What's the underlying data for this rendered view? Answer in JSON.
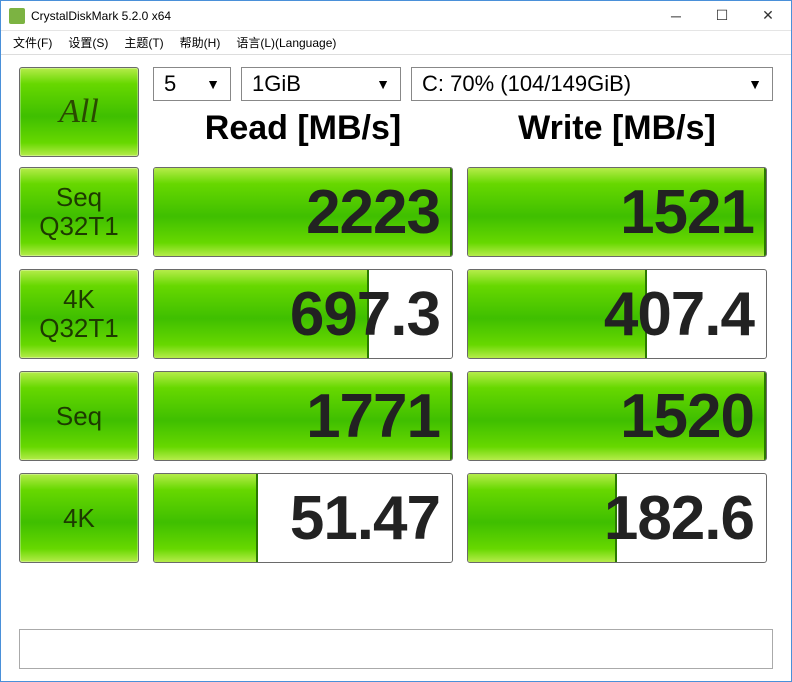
{
  "window": {
    "title": "CrystalDiskMark 5.2.0 x64"
  },
  "menu": {
    "file": "文件(F)",
    "settings": "设置(S)",
    "theme": "主题(T)",
    "help": "帮助(H)",
    "language": "语言(L)(Language)"
  },
  "controls": {
    "runs": "5",
    "size": "1GiB",
    "drive": "C: 70% (104/149GiB)"
  },
  "buttons": {
    "all": "All",
    "seq_q32t1_line1": "Seq",
    "seq_q32t1_line2": "Q32T1",
    "k4_q32t1_line1": "4K",
    "k4_q32t1_line2": "Q32T1",
    "seq": "Seq",
    "k4": "4K"
  },
  "headers": {
    "read": "Read [MB/s]",
    "write": "Write [MB/s]"
  },
  "results": {
    "seq_q32t1": {
      "read": "2223",
      "read_fill": 100,
      "write": "1521",
      "write_fill": 100
    },
    "k4_q32t1": {
      "read": "697.3",
      "read_fill": 72,
      "write": "407.4",
      "write_fill": 60
    },
    "seq": {
      "read": "1771",
      "read_fill": 100,
      "write": "1520",
      "write_fill": 100
    },
    "k4": {
      "read": "51.47",
      "read_fill": 35,
      "write": "182.6",
      "write_fill": 50
    }
  }
}
